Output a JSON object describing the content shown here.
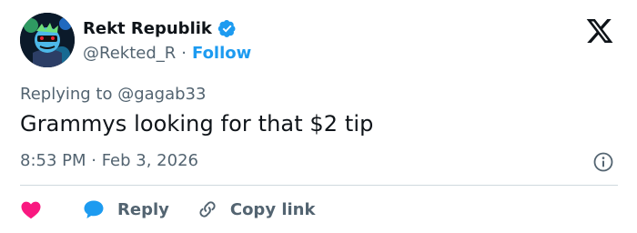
{
  "author": {
    "display_name": "Rekt Republik",
    "handle": "@Rekted_R",
    "separator": "·",
    "follow_label": "Follow"
  },
  "reply_context": {
    "prefix": "Replying to ",
    "mention": "@gagab33"
  },
  "tweet": {
    "text": "Grammys looking for that $2 tip",
    "timestamp": "8:53 PM · Feb 3, 2026"
  },
  "actions": {
    "reply_label": "Reply",
    "copy_link_label": "Copy link"
  },
  "icons": {
    "verified": "verified-badge-icon",
    "brand": "x-logo-icon",
    "info": "info-icon",
    "like": "heart-icon",
    "reply": "speech-bubble-icon",
    "copy": "link-icon"
  },
  "colors": {
    "primary_text": "#0f1419",
    "secondary_text": "#536471",
    "accent": "#1d9bf0",
    "like": "#f91880",
    "divider": "#cfd9de"
  }
}
